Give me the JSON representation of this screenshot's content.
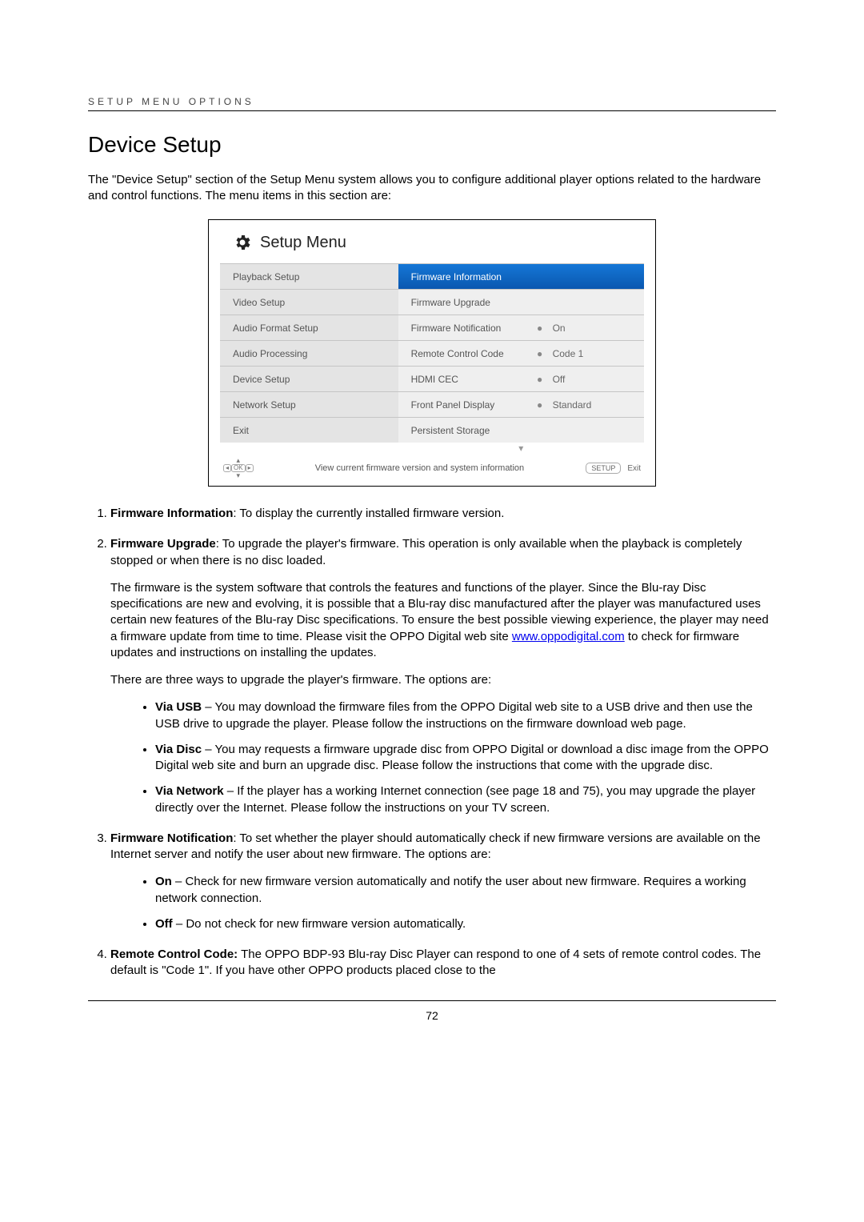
{
  "header": {
    "label": "SETUP MENU OPTIONS"
  },
  "title": "Device Setup",
  "intro": "The \"Device Setup\" section of the Setup Menu system allows you to configure additional player options related to the hardware and control functions.  The menu items in this section are:",
  "setup_menu": {
    "title": "Setup Menu",
    "left": [
      "Playback Setup",
      "Video Setup",
      "Audio Format Setup",
      "Audio Processing",
      "Device Setup",
      "Network Setup",
      "Exit"
    ],
    "right": [
      {
        "label": "Firmware Information",
        "value": "",
        "highlighted": true
      },
      {
        "label": "Firmware Upgrade",
        "value": ""
      },
      {
        "label": "Firmware Notification",
        "value": "On"
      },
      {
        "label": "Remote Control Code",
        "value": "Code 1"
      },
      {
        "label": "HDMI CEC",
        "value": "Off"
      },
      {
        "label": "Front Panel Display",
        "value": "Standard"
      },
      {
        "label": "Persistent Storage",
        "value": ""
      }
    ],
    "hint": "View current firmware version and system information",
    "setup_button": "SETUP",
    "exit_label": "Exit"
  },
  "items": {
    "i1": {
      "title": "Firmware Information",
      "body": ": To display the currently installed firmware version."
    },
    "i2": {
      "title": "Firmware Upgrade",
      "body_a": ":  To upgrade the player's firmware.  This operation is only available when the playback is completely stopped or when there is no disc loaded.",
      "para1_a": "The firmware is the system software that controls the features and functions of the player.  Since the Blu-ray Disc specifications are new and evolving, it is possible that a Blu-ray disc manufactured after the player was manufactured uses certain new features of the Blu-ray Disc specifications.  To ensure the best possible viewing experience, the player may need a firmware update from time to time.  Please visit the OPPO Digital web site ",
      "link": "www.oppodigital.com",
      "para1_b": " to check for firmware updates and instructions on installing the updates.",
      "para2": "There are three ways to upgrade the player's firmware.  The options are:",
      "bullets": {
        "b1_title": "Via USB",
        "b1_body": " – You may download the firmware files from the OPPO Digital web site to a USB drive and then use the USB drive to upgrade the player.  Please follow the instructions on the firmware download web page.",
        "b2_title": "Via Disc",
        "b2_body": " – You may requests a firmware upgrade disc from OPPO Digital or download a disc image from the OPPO Digital web site and burn an upgrade disc.  Please follow the instructions that come with the upgrade disc.",
        "b3_title": "Via Network",
        "b3_body": " – If the player has a working Internet connection (see page 18 and 75), you may upgrade the player directly over the Internet.  Please follow the instructions on your TV screen."
      }
    },
    "i3": {
      "title": "Firmware Notification",
      "body": ": To set whether the player should automatically check if new firmware versions are available on the Internet server and notify the user about new firmware.  The options are:",
      "bullets": {
        "b1_title": "On",
        "b1_body": " – Check for new firmware version automatically and notify the user about new firmware. Requires a working network connection.",
        "b2_title": "Off",
        "b2_body": " – Do not check for new firmware version automatically."
      }
    },
    "i4": {
      "title": "Remote Control Code:",
      "body": " The OPPO BDP-93 Blu-ray Disc Player can respond to one of 4 sets of remote control codes.  The default is \"Code 1\". If you have other OPPO products placed close to the"
    }
  },
  "page_number": "72"
}
